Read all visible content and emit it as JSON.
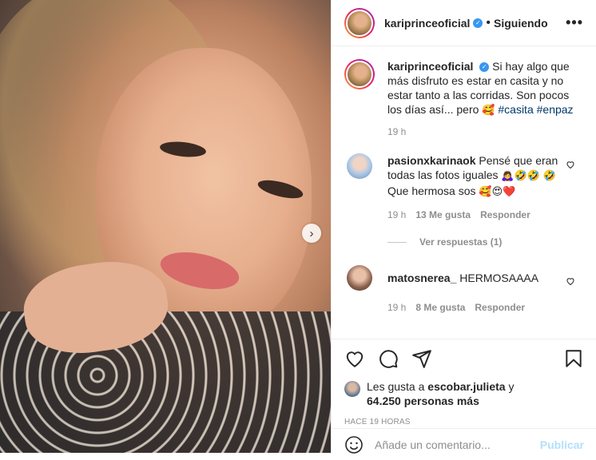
{
  "post": {
    "username": "kariprinceoficial",
    "follow_status": "Siguiendo",
    "separator": "•",
    "more": "•••",
    "verified_mark": "✓"
  },
  "caption": {
    "text": "Si hay algo que más disfruto es estar en casita y no estar tanto a las corridas. Son pocos los días así... pero",
    "emoji": "🥰",
    "tags": "#casita #enpaz",
    "time": "19 h"
  },
  "comments": [
    {
      "username": "pasionxkarinaok",
      "text": "Pensé que eran todas las fotos iguales",
      "emojis": "🙇‍♀️🤣🤣",
      "text2": "Que hermosa sos",
      "emojis_before": "🤣",
      "emojis2": "🥰😍❤️",
      "time": "19 h",
      "likes": "13 Me gusta",
      "reply": "Responder",
      "view_replies": "Ver respuestas (1)"
    },
    {
      "username": "matosnerea_",
      "text": "HERMOSAAAA",
      "time": "19 h",
      "likes": "8 Me gusta",
      "reply": "Responder"
    }
  ],
  "likes_summary": {
    "prefix": "Les gusta a",
    "user": "escobar.julieta",
    "connector": "y",
    "count": "64.250 personas más"
  },
  "posted_ago": "HACE 19 HORAS",
  "composer": {
    "placeholder": "Añade un comentario...",
    "publish": "Publicar"
  },
  "icons": {
    "next": "chevron-right-icon",
    "like": "heart-icon",
    "comment": "comment-icon",
    "share": "paper-plane-icon",
    "save": "bookmark-icon",
    "emoji": "smiley-icon",
    "comment_like": "small-heart-icon"
  },
  "colors": {
    "verified": "#3897f0",
    "tag": "#00376b",
    "secondary_text": "#8e8e8e",
    "publish_disabled": "#b2dffc"
  }
}
